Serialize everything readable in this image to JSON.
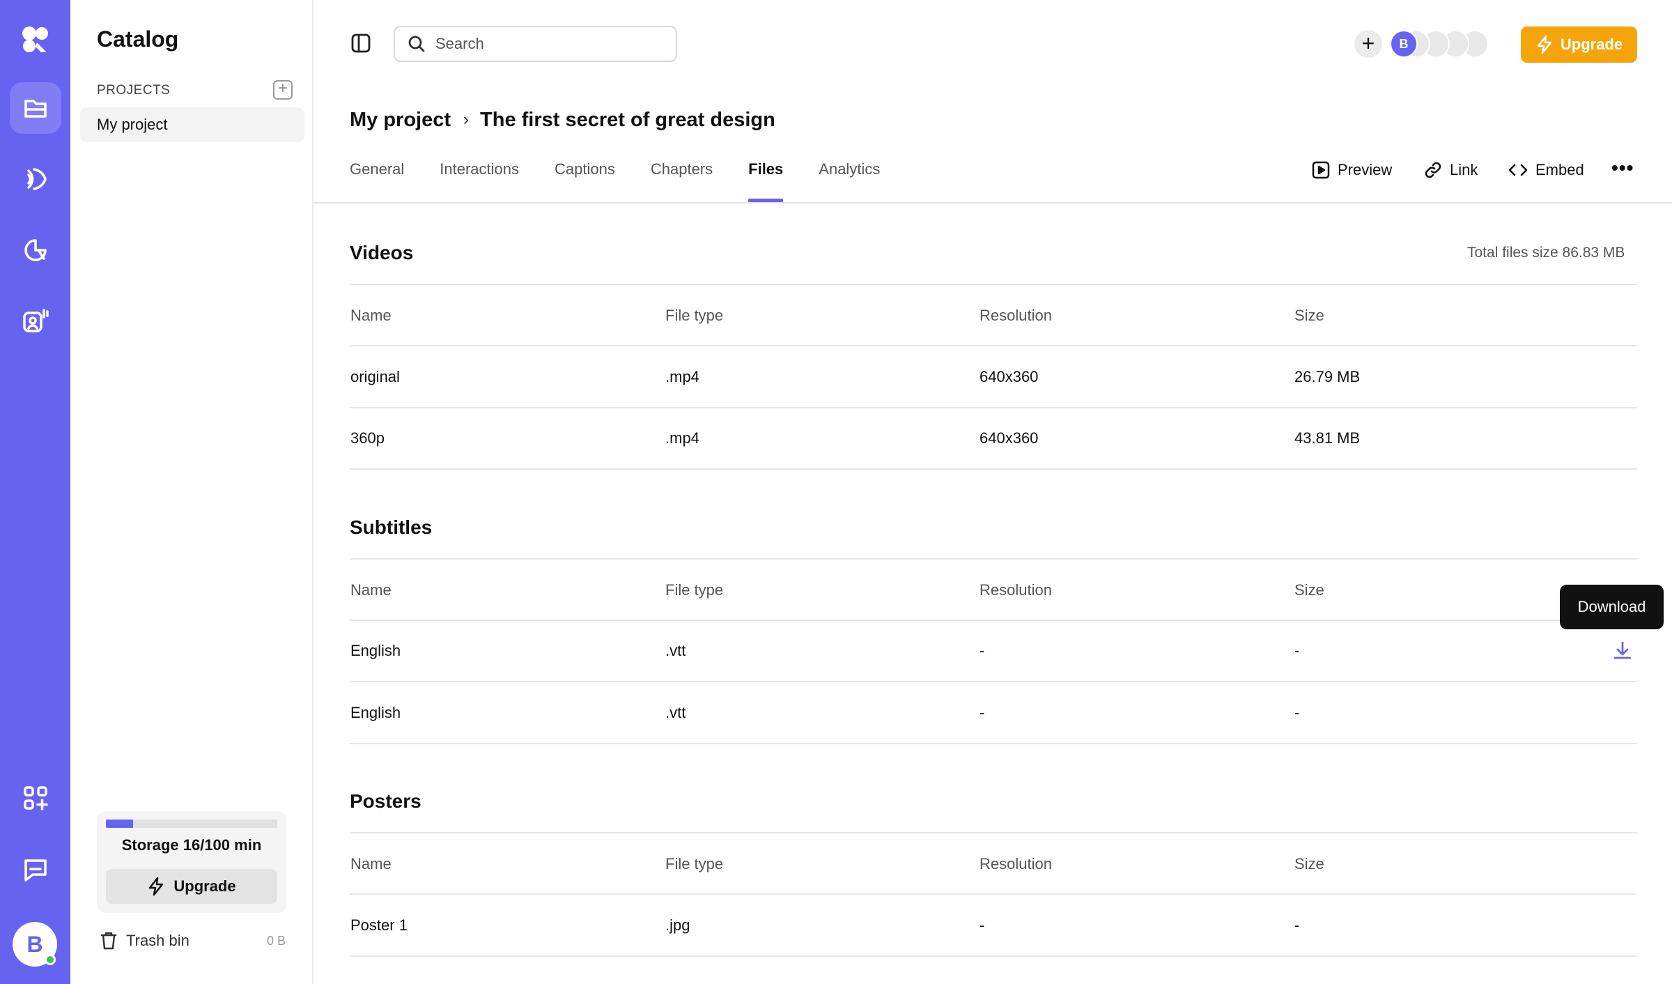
{
  "catalog": {
    "title": "Catalog",
    "projects_label": "PROJECTS",
    "project_name": "My project",
    "storage": {
      "text": "Storage 16/100 min",
      "used_fraction": 0.16
    },
    "upgrade_label": "Upgrade",
    "trash_label": "Trash bin",
    "trash_size": "0 B"
  },
  "topbar": {
    "search_placeholder": "Search",
    "avatar_initial": "B",
    "upgrade_label": "Upgrade"
  },
  "breadcrumb": {
    "project": "My project",
    "page": "The first secret of great design"
  },
  "tabs": [
    {
      "label": "General"
    },
    {
      "label": "Interactions"
    },
    {
      "label": "Captions"
    },
    {
      "label": "Chapters"
    },
    {
      "label": "Files",
      "active": true
    },
    {
      "label": "Analytics"
    }
  ],
  "actions": {
    "preview": "Preview",
    "link": "Link",
    "embed": "Embed",
    "more": "•••"
  },
  "columns": [
    "Name",
    "File type",
    "Resolution",
    "Size"
  ],
  "videos": {
    "title": "Videos",
    "total_size": "Total files size 86.83 MB",
    "rows": [
      [
        "original",
        ".mp4",
        "640x360",
        "26.79 MB"
      ],
      [
        "360p",
        ".mp4",
        "640x360",
        "43.81 MB"
      ]
    ]
  },
  "subtitles": {
    "title": "Subtitles",
    "rows": [
      [
        "English",
        ".vtt",
        "-",
        "-"
      ],
      [
        "English",
        ".vtt",
        "-",
        "-"
      ]
    ]
  },
  "posters": {
    "title": "Posters",
    "rows": [
      [
        "Poster 1",
        ".jpg",
        "-",
        "-"
      ]
    ]
  },
  "tooltip": "Download",
  "user": {
    "initial": "B"
  },
  "colors": {
    "accent": "#6663f0",
    "upgrade": "#f5a50b"
  },
  "icons": [
    "logo-icon",
    "folder-icon",
    "broadcast-icon",
    "analytics-icon",
    "team-icon",
    "apps-icon",
    "chat-icon",
    "sidebar-toggle-icon",
    "search-icon",
    "plus-icon",
    "bolt-icon",
    "chevron-right-icon",
    "play-icon",
    "link-icon",
    "code-icon",
    "more-icon",
    "download-icon",
    "trash-icon"
  ]
}
